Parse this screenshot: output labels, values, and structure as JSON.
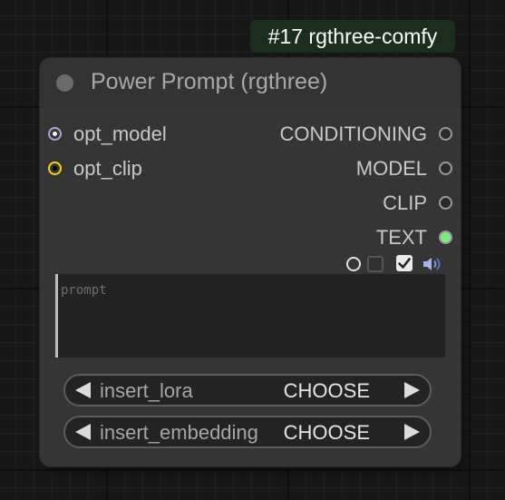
{
  "badge": {
    "text": "#17 rgthree-comfy"
  },
  "node": {
    "title": "Power Prompt (rgthree)",
    "inputs": [
      {
        "label": "opt_model",
        "color": "#b39ddb"
      },
      {
        "label": "opt_clip",
        "color": "#ffd500"
      }
    ],
    "outputs": [
      {
        "label": "CONDITIONING",
        "connected": false
      },
      {
        "label": "MODEL",
        "connected": false
      },
      {
        "label": "CLIP",
        "connected": false
      },
      {
        "label": "TEXT",
        "connected": true,
        "color": "#7bec7b"
      }
    ],
    "toolbar": {
      "icons": [
        "circle-icon",
        "checkbox-unchecked-icon",
        "checkbox-checked-icon",
        "speaker-icon"
      ]
    },
    "prompt": {
      "placeholder": "prompt",
      "value": ""
    },
    "widgets": [
      {
        "label": "insert_lora",
        "value": "CHOOSE"
      },
      {
        "label": "insert_embedding",
        "value": "CHOOSE"
      }
    ]
  },
  "colors": {
    "canvas": "#171717",
    "node_body": "#353535",
    "badge_bg": "#1b2d1c"
  }
}
